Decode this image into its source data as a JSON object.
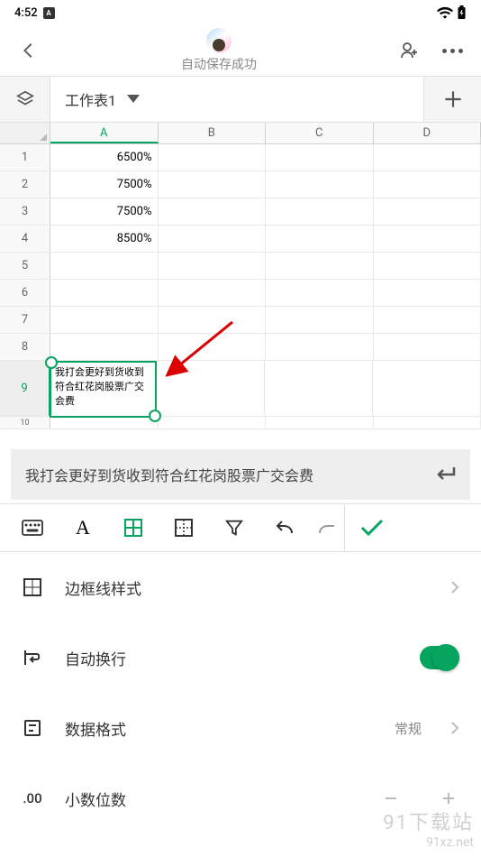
{
  "status": {
    "time": "4:52"
  },
  "header": {
    "save_text": "自动保存成功"
  },
  "sheet": {
    "name": "工作表1"
  },
  "columns": [
    "A",
    "B",
    "C",
    "D"
  ],
  "rows": [
    {
      "n": "1",
      "a": "6500%"
    },
    {
      "n": "2",
      "a": "7500%"
    },
    {
      "n": "3",
      "a": "7500%"
    },
    {
      "n": "4",
      "a": "8500%"
    },
    {
      "n": "5",
      "a": ""
    },
    {
      "n": "6",
      "a": ""
    },
    {
      "n": "7",
      "a": ""
    },
    {
      "n": "8",
      "a": ""
    },
    {
      "n": "9",
      "a": "我打会更好到货收到符合红花岗股票广交会费"
    },
    {
      "n": "10",
      "a": ""
    }
  ],
  "formula": {
    "value": "我打会更好到货收到符合红花岗股票广交会费"
  },
  "settings": {
    "border": "边框线样式",
    "wrap": "自动换行",
    "format_label": "数据格式",
    "format_value": "常规",
    "decimal": "小数位数"
  },
  "watermark": {
    "line1": "91下载站",
    "line2": "91xz.net"
  }
}
